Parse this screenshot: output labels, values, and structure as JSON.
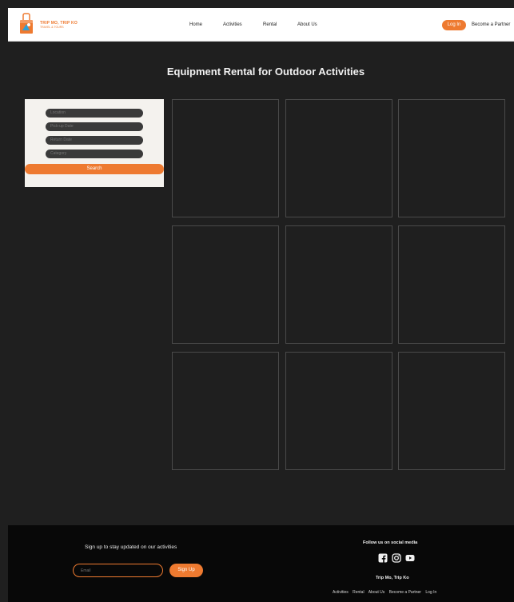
{
  "header": {
    "logo_text": "TRIP MO, TRIP KO",
    "logo_sub": "TRAVEL & TOURS",
    "nav": [
      "Home",
      "Activities",
      "Rental",
      "About Us"
    ],
    "login_label": "Log In",
    "partner_label": "Become a Partner",
    "accent": "#ee7a30"
  },
  "main": {
    "title": "Equipment Rental for Outdoor Activities",
    "search": {
      "location_placeholder": "Location",
      "pickup_placeholder": "Pick-up Date",
      "return_placeholder": "Return Date",
      "category_placeholder": "Category",
      "search_label": "Search"
    }
  },
  "footer": {
    "signup_text": "Sign up to stay updated on our activities",
    "email_placeholder": "Email",
    "signup_label": "Sign Up",
    "follow_text": "Follow us on social media",
    "brand": "Trip Mo, Trip Ko",
    "links": [
      "Activities",
      "Rental",
      "About Us",
      "Become a Partner",
      "Log In"
    ],
    "social_icons": [
      "facebook-icon",
      "instagram-icon",
      "youtube-icon"
    ]
  }
}
